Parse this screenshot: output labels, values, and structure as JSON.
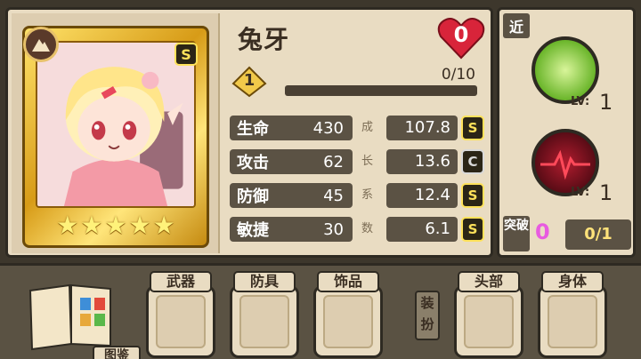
{
  "character": {
    "name": "兔牙",
    "rank": "S",
    "stars": 5,
    "class_icon": "mountain-icon",
    "favor": "0",
    "level": "1",
    "exp_text": "0/10",
    "exp_fraction": 0.0
  },
  "stats": [
    {
      "label": "生命",
      "value": "430",
      "growth_char": "成",
      "growth": "107.8",
      "grade": "S"
    },
    {
      "label": "攻击",
      "value": "62",
      "growth_char": "长",
      "growth": "13.6",
      "grade": "C"
    },
    {
      "label": "防御",
      "value": "45",
      "growth_char": "系",
      "growth": "12.4",
      "grade": "S"
    },
    {
      "label": "敏捷",
      "value": "30",
      "growth_char": "数",
      "growth": "6.1",
      "grade": "S"
    }
  ],
  "skills_panel": {
    "range_tag": "近",
    "skills": [
      {
        "icon": "carrot-skill-icon",
        "lv_label": "LV:",
        "lv": "1"
      },
      {
        "icon": "heartbeat-skill-icon",
        "lv_label": "LV:",
        "lv": "1"
      }
    ],
    "breakthrough_label": "突破",
    "breakthrough_count": "0",
    "breakthrough_progress": "0/1"
  },
  "equipment": {
    "book_label": "图鉴",
    "equip_button": "装扮",
    "slots": [
      "武器",
      "防具",
      "饰品",
      "头部",
      "身体"
    ]
  },
  "colors": {
    "panel": "#e9dcc2",
    "dark": "#5b5244",
    "gold": "#ffe25a",
    "heart": "#d8243a",
    "break_pink": "#e85be0"
  }
}
